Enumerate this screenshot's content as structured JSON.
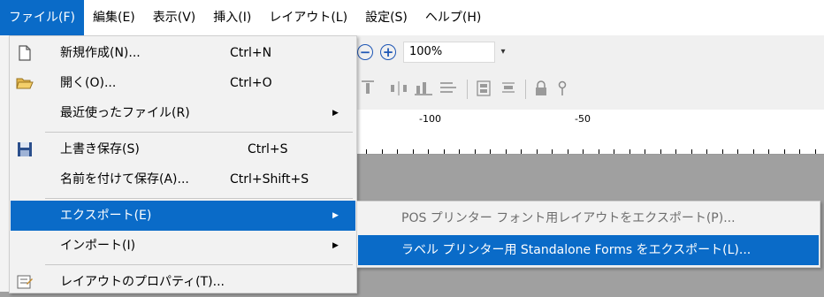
{
  "menubar": {
    "items": [
      {
        "label": "ファイル(F)"
      },
      {
        "label": "編集(E)"
      },
      {
        "label": "表示(V)"
      },
      {
        "label": "挿入(I)"
      },
      {
        "label": "レイアウト(L)"
      },
      {
        "label": "設定(S)"
      },
      {
        "label": "ヘルプ(H)"
      }
    ]
  },
  "toolbar": {
    "zoom_value": "100%",
    "zoom_minus": "−",
    "zoom_plus": "+",
    "dropdown_arrow": "▾"
  },
  "ruler": {
    "labels": [
      "-100",
      "-50"
    ]
  },
  "file_menu": {
    "items": [
      {
        "label": "新規作成(N)...",
        "shortcut": "Ctrl+N",
        "icon": "new-document-icon"
      },
      {
        "label": "開く(O)...",
        "shortcut": "Ctrl+O",
        "icon": "open-folder-icon"
      },
      {
        "label": "最近使ったファイル(R)",
        "shortcut": "",
        "icon": "",
        "arrow": "▶"
      },
      {
        "label": "上書き保存(S)",
        "shortcut": "Ctrl+S",
        "icon": "save-disk-icon"
      },
      {
        "label": "名前を付けて保存(A)...",
        "shortcut": "Ctrl+Shift+S",
        "icon": ""
      },
      {
        "label": "エクスポート(E)",
        "shortcut": "",
        "icon": "",
        "arrow": "▶"
      },
      {
        "label": "インポート(I)",
        "shortcut": "",
        "icon": "",
        "arrow": "▶"
      },
      {
        "label": "レイアウトのプロパティ(T)...",
        "shortcut": "",
        "icon": "properties-icon"
      }
    ]
  },
  "export_submenu": {
    "items": [
      {
        "label": "POS プリンター フォント用レイアウトをエクスポート(P)...",
        "enabled": false
      },
      {
        "label": "ラベル プリンター用 Standalone Forms をエクスポート(L)...",
        "enabled": true
      }
    ]
  },
  "colors": {
    "highlight": "#0a6bc8",
    "menu_background": "#f2f2f2",
    "workspace": "#a0a0a0"
  }
}
